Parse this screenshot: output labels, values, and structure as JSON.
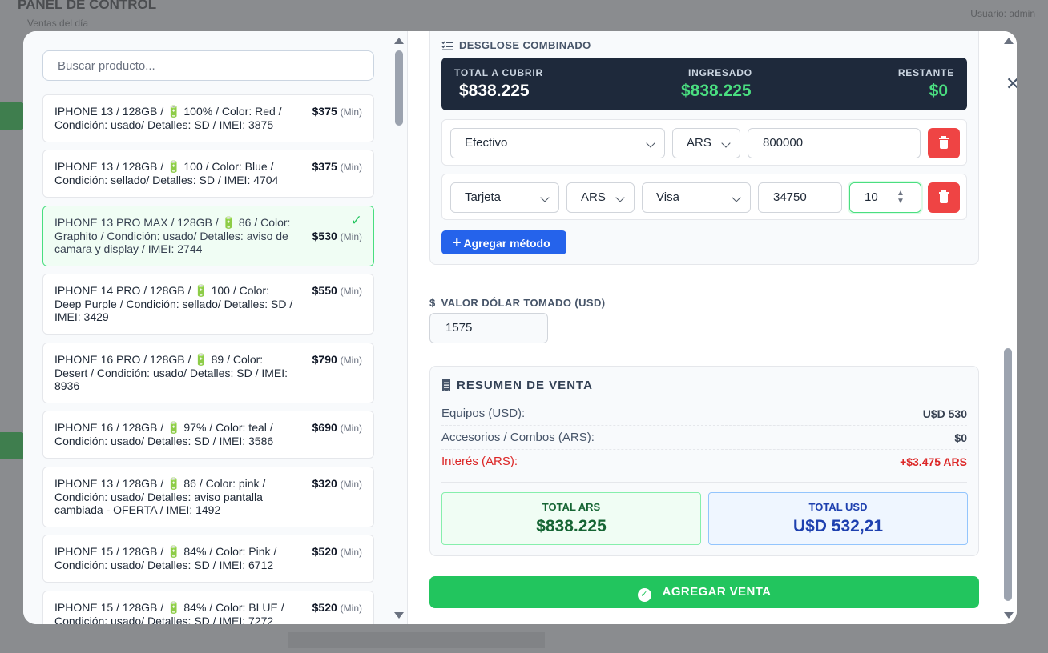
{
  "background": {
    "title": "PANEL DE CONTROL",
    "subtitle": "Ventas del día",
    "right_text": "Usuario: admin"
  },
  "search": {
    "placeholder": "Buscar producto..."
  },
  "products": [
    {
      "desc": "IPHONE 13 / 128GB / 🔋 100% / Color: Red / Condición: usado/ Detalles: SD / IMEI: 3875",
      "price": "$375",
      "min": "(Min)",
      "selected": false
    },
    {
      "desc": "IPHONE 13 / 128GB / 🔋 100 / Color: Blue / Condición: sellado/ Detalles: SD / IMEI: 4704",
      "price": "$375",
      "min": "(Min)",
      "selected": false
    },
    {
      "desc": "IPHONE 13 PRO MAX / 128GB / 🔋 86 / Color: Graphito / Condición: usado/ Detalles: aviso de camara y display / IMEI: 2744",
      "price": "$530",
      "min": "(Min)",
      "selected": true
    },
    {
      "desc": "IPHONE 14 PRO / 128GB / 🔋 100 / Color: Deep Purple / Condición: sellado/ Detalles: SD / IMEI: 3429",
      "price": "$550",
      "min": "(Min)",
      "selected": false
    },
    {
      "desc": "IPHONE 16 PRO / 128GB / 🔋 89 / Color: Desert / Condición: usado/ Detalles: SD / IMEI: 8936",
      "price": "$790",
      "min": "(Min)",
      "selected": false
    },
    {
      "desc": "IPHONE 16 / 128GB / 🔋 97% / Color: teal / Condición: usado/ Detalles: SD / IMEI: 3586",
      "price": "$690",
      "min": "(Min)",
      "selected": false
    },
    {
      "desc": "IPHONE 13 / 128GB / 🔋 86 / Color: pink / Condición: usado/ Detalles: aviso pantalla cambiada - OFERTA / IMEI: 1492",
      "price": "$320",
      "min": "(Min)",
      "selected": false
    },
    {
      "desc": "IPHONE 15 / 128GB / 🔋 84% / Color: Pink / Condición: usado/ Detalles: SD / IMEI: 6712",
      "price": "$520",
      "min": "(Min)",
      "selected": false
    },
    {
      "desc": "IPHONE 15 / 128GB / 🔋 84% / Color: BLUE / Condición: usado/ Detalles: SD / IMEI: 7272",
      "price": "$520",
      "min": "(Min)",
      "selected": false
    }
  ],
  "combined": {
    "title": "DESGLOSE COMBINADO",
    "total_label": "TOTAL A CUBRIR",
    "total_value": "$838.225",
    "ingresado_label": "INGRESADO",
    "ingresado_value": "$838.225",
    "restante_label": "RESTANTE",
    "restante_value": "$0",
    "methods": [
      {
        "method": "Efectivo",
        "currency": "ARS",
        "amount": "800000"
      },
      {
        "method": "Tarjeta",
        "currency": "ARS",
        "card": "Visa",
        "amount": "34750",
        "installments": "10"
      }
    ],
    "add_method_label": "Agregar método"
  },
  "dollar": {
    "label": "VALOR DÓLAR TOMADO (USD)",
    "value": "1575"
  },
  "summary": {
    "title": "RESUMEN DE VENTA",
    "equipos_label": "Equipos (USD):",
    "equipos_value": "U$D 530",
    "accesorios_label": "Accesorios / Combos (ARS):",
    "accesorios_value": "$0",
    "interes_label": "Interés (ARS):",
    "interes_value": "+$3.475 ARS",
    "total_ars_label": "TOTAL ARS",
    "total_ars_value": "$838.225",
    "total_usd_label": "TOTAL USD",
    "total_usd_value": "U$D 532,21"
  },
  "submit_label": "AGREGAR VENTA",
  "colors": {
    "accent_green": "#22c55e",
    "accent_blue": "#2563eb",
    "danger": "#ef4444",
    "dark_panel": "#1e293b",
    "mint": "#4ade80"
  },
  "icons": {
    "close": "close-icon",
    "list": "list-check-icon",
    "dollar": "dollar-icon",
    "receipt": "receipt-icon",
    "trash": "trash-icon",
    "check": "check-circle-icon",
    "battery": "battery-icon"
  }
}
